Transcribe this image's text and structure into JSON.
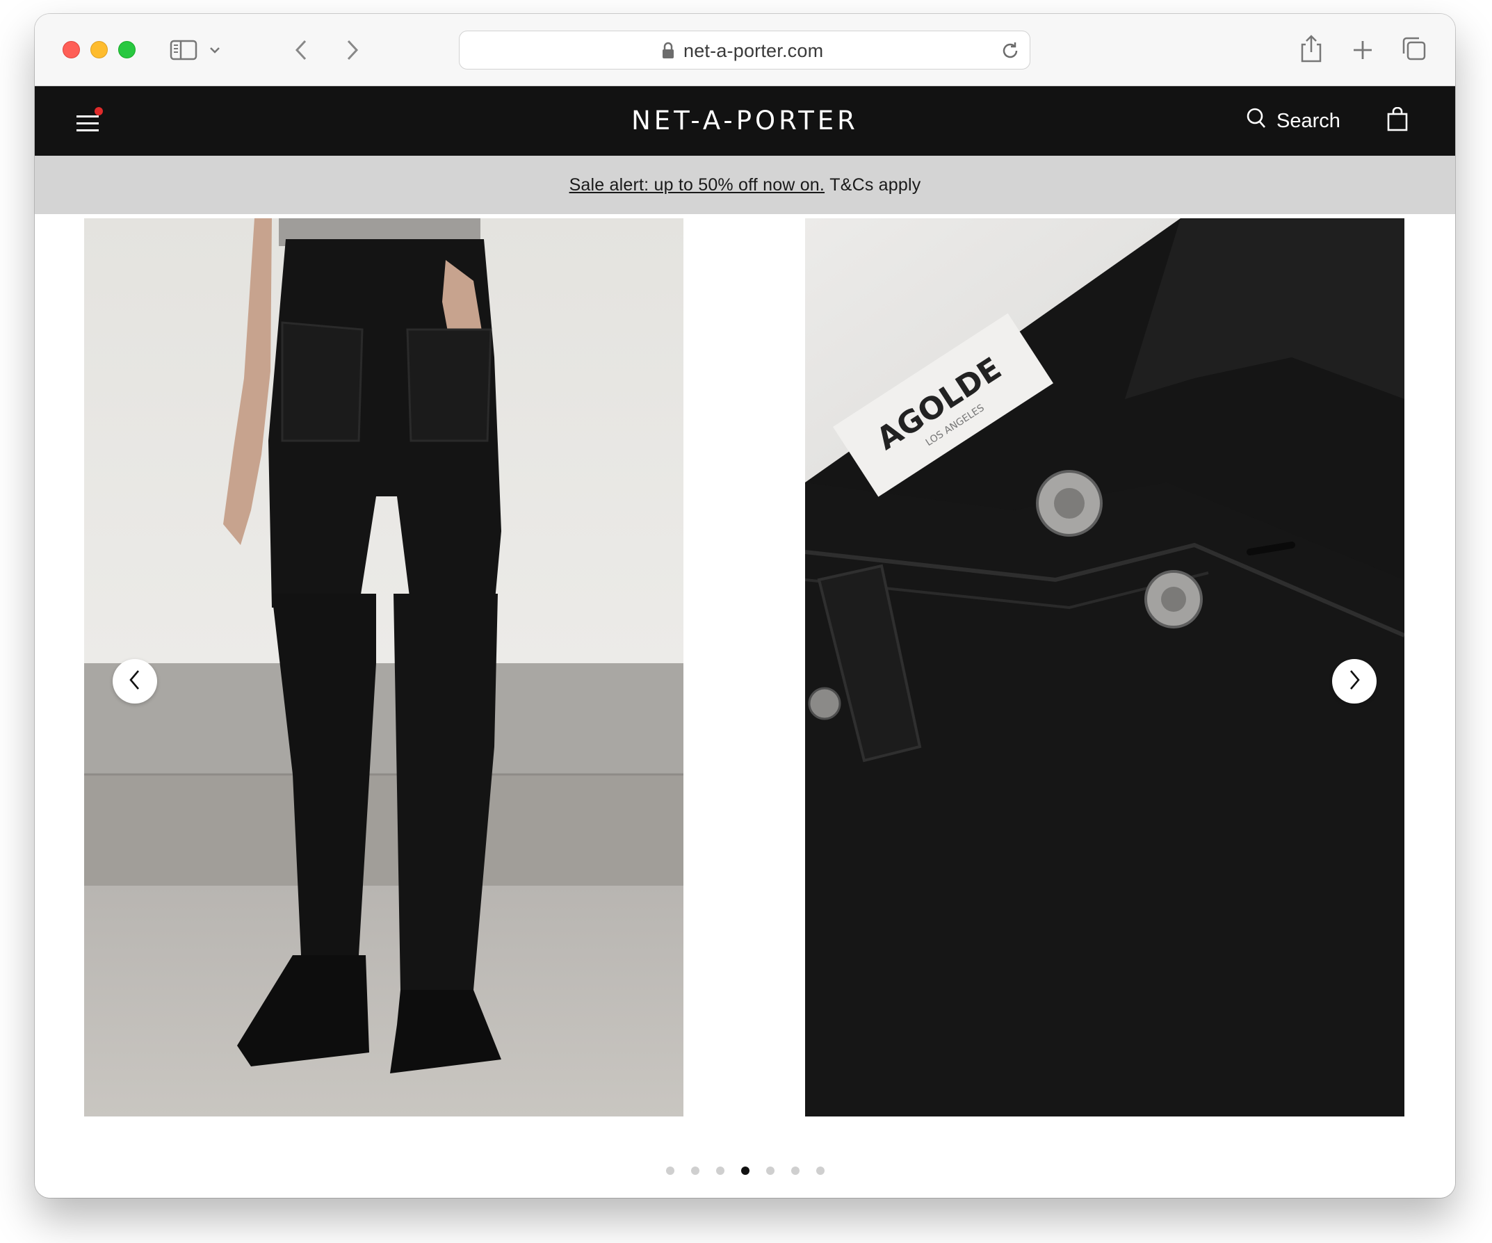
{
  "browser": {
    "url": "net-a-porter.com"
  },
  "site": {
    "logo": "NET-A-PORTER",
    "search_label": "Search"
  },
  "sale_banner": {
    "link_text": "Sale alert: up to 50% off now on.",
    "suffix_text": "T&Cs apply"
  },
  "gallery": {
    "images": [
      {
        "description_icon": "jeans-back-view-image"
      },
      {
        "description_icon": "jeans-waistband-closeup-image",
        "label_text": "AGOLDE",
        "label_subtext": "LOS ANGELES"
      }
    ],
    "dots_count": 7,
    "active_dot": 4
  },
  "colors": {
    "header_bg": "#121212",
    "sale_bar_bg": "#d4d4d4",
    "notification_dot": "#e02b2b"
  }
}
